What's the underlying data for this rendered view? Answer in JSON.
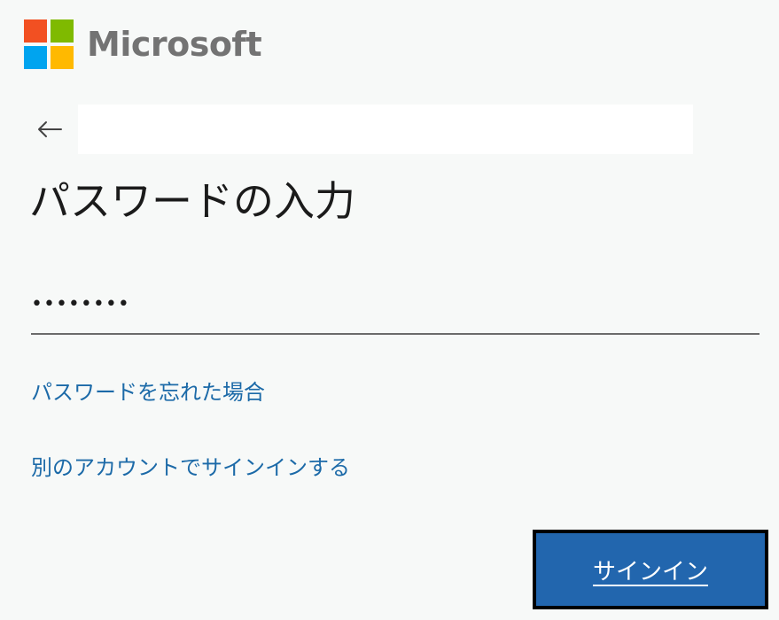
{
  "brand": {
    "name": "Microsoft",
    "colors": {
      "red": "#f25022",
      "green": "#7fba00",
      "blue": "#00a4ef",
      "yellow": "#ffb900"
    }
  },
  "identity": {
    "back_icon": "arrow-left-icon",
    "value": ""
  },
  "page": {
    "title": "パスワードの入力"
  },
  "password": {
    "value": "••••••••"
  },
  "links": {
    "forgot_password": "パスワードを忘れた場合",
    "other_account": "別のアカウントでサインインする"
  },
  "actions": {
    "sign_in": "サインイン"
  },
  "theme": {
    "accent": "#2266ae",
    "link": "#1c6aa8",
    "background": "#f7f9f8"
  }
}
